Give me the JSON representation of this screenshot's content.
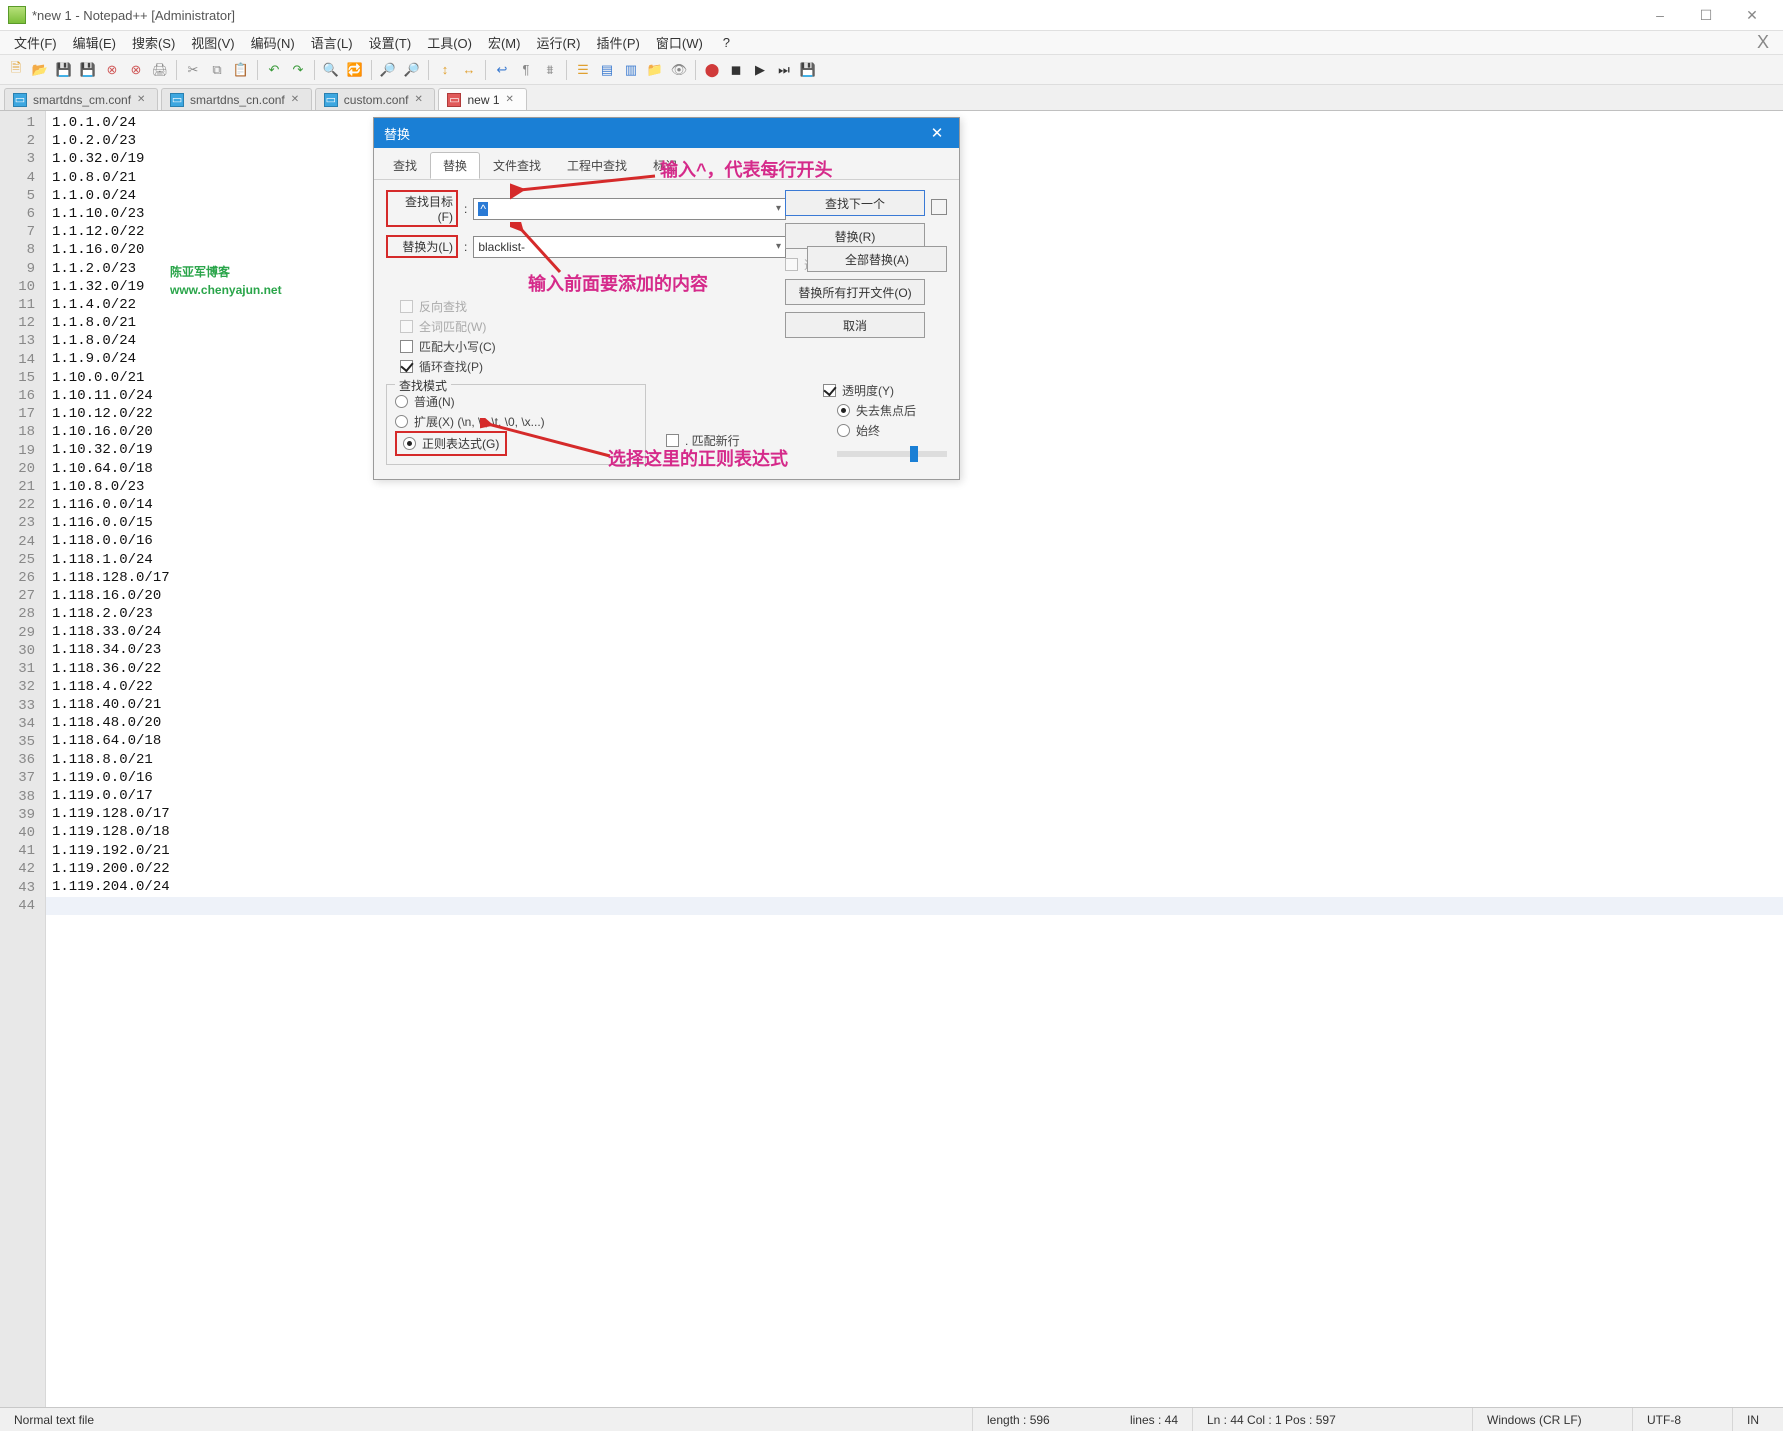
{
  "titlebar": {
    "title": "*new 1 - Notepad++ [Administrator]"
  },
  "menu": {
    "file": "文件(F)",
    "edit": "编辑(E)",
    "search": "搜索(S)",
    "view": "视图(V)",
    "encoding": "编码(N)",
    "language": "语言(L)",
    "settings": "设置(T)",
    "tools": "工具(O)",
    "macro": "宏(M)",
    "run": "运行(R)",
    "plugins": "插件(P)",
    "window": "窗口(W)",
    "help": "?"
  },
  "tabs": [
    {
      "name": "smartdns_cm.conf",
      "icon": "blue"
    },
    {
      "name": "smartdns_cn.conf",
      "icon": "blue"
    },
    {
      "name": "custom.conf",
      "icon": "blue"
    },
    {
      "name": "new 1",
      "icon": "red",
      "active": true
    }
  ],
  "watermark": {
    "line1": "陈亚军博客",
    "line2": "www.chenyajun.net"
  },
  "editor": {
    "lines": [
      "1.0.1.0/24",
      "1.0.2.0/23",
      "1.0.32.0/19",
      "1.0.8.0/21",
      "1.1.0.0/24",
      "1.1.10.0/23",
      "1.1.12.0/22",
      "1.1.16.0/20",
      "1.1.2.0/23",
      "1.1.32.0/19",
      "1.1.4.0/22",
      "1.1.8.0/21",
      "1.1.8.0/24",
      "1.1.9.0/24",
      "1.10.0.0/21",
      "1.10.11.0/24",
      "1.10.12.0/22",
      "1.10.16.0/20",
      "1.10.32.0/19",
      "1.10.64.0/18",
      "1.10.8.0/23",
      "1.116.0.0/14",
      "1.116.0.0/15",
      "1.118.0.0/16",
      "1.118.1.0/24",
      "1.118.128.0/17",
      "1.118.16.0/20",
      "1.118.2.0/23",
      "1.118.33.0/24",
      "1.118.34.0/23",
      "1.118.36.0/22",
      "1.118.4.0/22",
      "1.118.40.0/21",
      "1.118.48.0/20",
      "1.118.64.0/18",
      "1.118.8.0/21",
      "1.119.0.0/16",
      "1.119.0.0/17",
      "1.119.128.0/17",
      "1.119.128.0/18",
      "1.119.192.0/21",
      "1.119.200.0/22",
      "1.119.204.0/24"
    ],
    "blank_line": 44
  },
  "dialog": {
    "title": "替换",
    "tabs": {
      "find": "查找",
      "replace": "替换",
      "findfiles": "文件查找",
      "findproj": "工程中查找",
      "mark": "标记"
    },
    "labels": {
      "find_target": "查找目标(F)",
      "replace_with": "替换为(L)"
    },
    "find_value": "^",
    "replace_value": "blacklist-",
    "buttons": {
      "find_next": "查找下一个",
      "replace": "替换(R)",
      "replace_all": "全部替换(A)",
      "replace_all_open": "替换所有打开文件(O)",
      "cancel": "取消"
    },
    "checks": {
      "backward": "反向查找",
      "whole_word": "全词匹配(W)",
      "match_case": "匹配大小写(C)",
      "wrap": "循环查找(P)",
      "in_selection": "选取范围内(I)",
      "dot_newline": ". 匹配新行"
    },
    "search_mode": {
      "legend": "查找模式",
      "normal": "普通(N)",
      "extended": "扩展(X) (\\n, \\r, \\t, \\0, \\x...)",
      "regex": "正则表达式(G)"
    },
    "transparency": {
      "label": "透明度(Y)",
      "on_lose_focus": "失去焦点后",
      "always": "始终"
    }
  },
  "annotations": {
    "a1": "输入^，代表每行开头",
    "a2": "输入前面要添加的内容",
    "a3": "选择这里的正则表达式"
  },
  "status": {
    "type": "Normal text file",
    "length": "length : 596",
    "lines": "lines : 44",
    "pos": "Ln : 44    Col : 1    Pos : 597",
    "eol": "Windows (CR LF)",
    "encoding": "UTF-8",
    "ins": "IN"
  }
}
